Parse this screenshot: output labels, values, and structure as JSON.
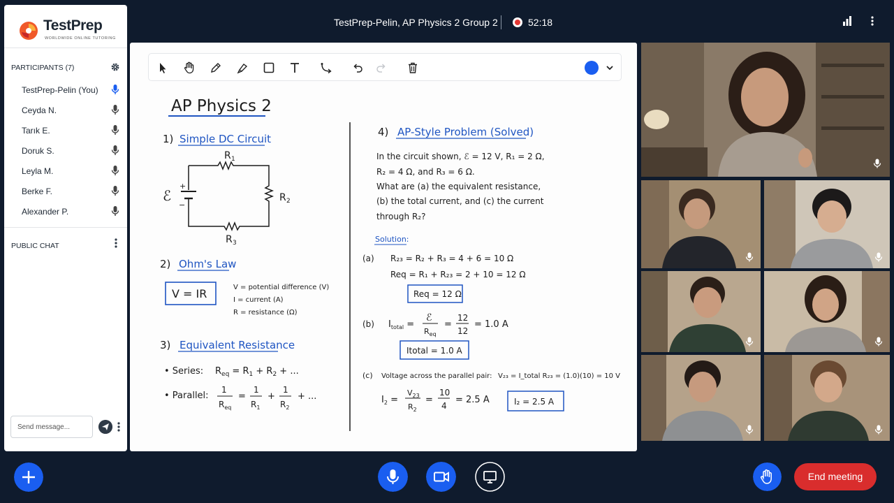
{
  "app": {
    "brand": "TestPrep",
    "tagline": "WORLDWIDE ONLINE TUTORING"
  },
  "meeting": {
    "title": "TestPrep-Pelin, AP Physics 2 Group 2",
    "timer": "52:18",
    "end_label": "End meeting"
  },
  "participants": {
    "label": "PARTICIPANTS (7)",
    "items": [
      {
        "name": "TestPrep-Pelin (You)",
        "mic_active": true
      },
      {
        "name": "Ceyda N.",
        "mic_active": false
      },
      {
        "name": "Tarık E.",
        "mic_active": false
      },
      {
        "name": "Doruk S.",
        "mic_active": false
      },
      {
        "name": "Leyla M.",
        "mic_active": false
      },
      {
        "name": "Berke F.",
        "mic_active": false
      },
      {
        "name": "Alexander P.",
        "mic_active": false
      }
    ]
  },
  "chat": {
    "label": "PUBLIC CHAT",
    "placeholder": "Send message..."
  },
  "toolbar": {
    "tools": [
      "cursor-icon",
      "hand-icon",
      "pencil-icon",
      "highlighter-icon",
      "rectangle-icon",
      "text-icon",
      "connector-icon",
      "undo-icon",
      "redo-icon",
      "trash-icon"
    ],
    "color": "#1a5ef0"
  },
  "whiteboard": {
    "title": "AP Physics 2",
    "s1_heading": "1)",
    "s1_title": "Simple DC Circuit",
    "emf": "ℰ",
    "plus": "+",
    "minus": "−",
    "r1": "R",
    "r1_sub": "1",
    "r2": "R",
    "r2_sub": "2",
    "r3": "R",
    "r3_sub": "3",
    "s2_heading": "2)",
    "s2_title": "Ohm's Law",
    "ohm_formula": "V = IR",
    "ohm_v": "V = potential difference (V)",
    "ohm_i": "I = current (A)",
    "ohm_r": "R = resistance (Ω)",
    "s3_heading": "3)",
    "s3_title": "Equivalent Resistance",
    "series_label": "• Series:",
    "parallel_label": "• Parallel:",
    "s4_heading": "4)",
    "s4_title": "AP-Style Problem (Solved)",
    "q_line1": "In the circuit shown, ℰ = 12 V, R₁ = 2 Ω,",
    "q_line2": "R₂ = 4 Ω, and R₃ = 6 Ω.",
    "q_line3": "What are (a) the equivalent resistance,",
    "q_line4": "(b) the total current, and (c) the current",
    "q_line5": "through R₂?",
    "solution": "Solution:",
    "a_label": "(a)",
    "a_line1": "R₂₃ = R₂ + R₃ = 4 + 6 = 10 Ω",
    "a_line2": "Req = R₁ + R₂₃ = 2 + 10 = 12 Ω",
    "a_box": "Req = 12 Ω",
    "b_label": "(b)",
    "b_box": "Itotal = 1.0 A",
    "c_label": "(c)",
    "c_text": "Voltage across the parallel pair:",
    "c_formula": "V₂₃ = I_total R₂₃ = (1.0)(10) = 10 V",
    "c_box": "I₂ = 2.5 A"
  },
  "colors": {
    "bg": "#0f1b2d",
    "accent": "#1a5ef0",
    "end": "#d92d2d",
    "ink_blue": "#1f55c2",
    "rec": "#e53935"
  }
}
